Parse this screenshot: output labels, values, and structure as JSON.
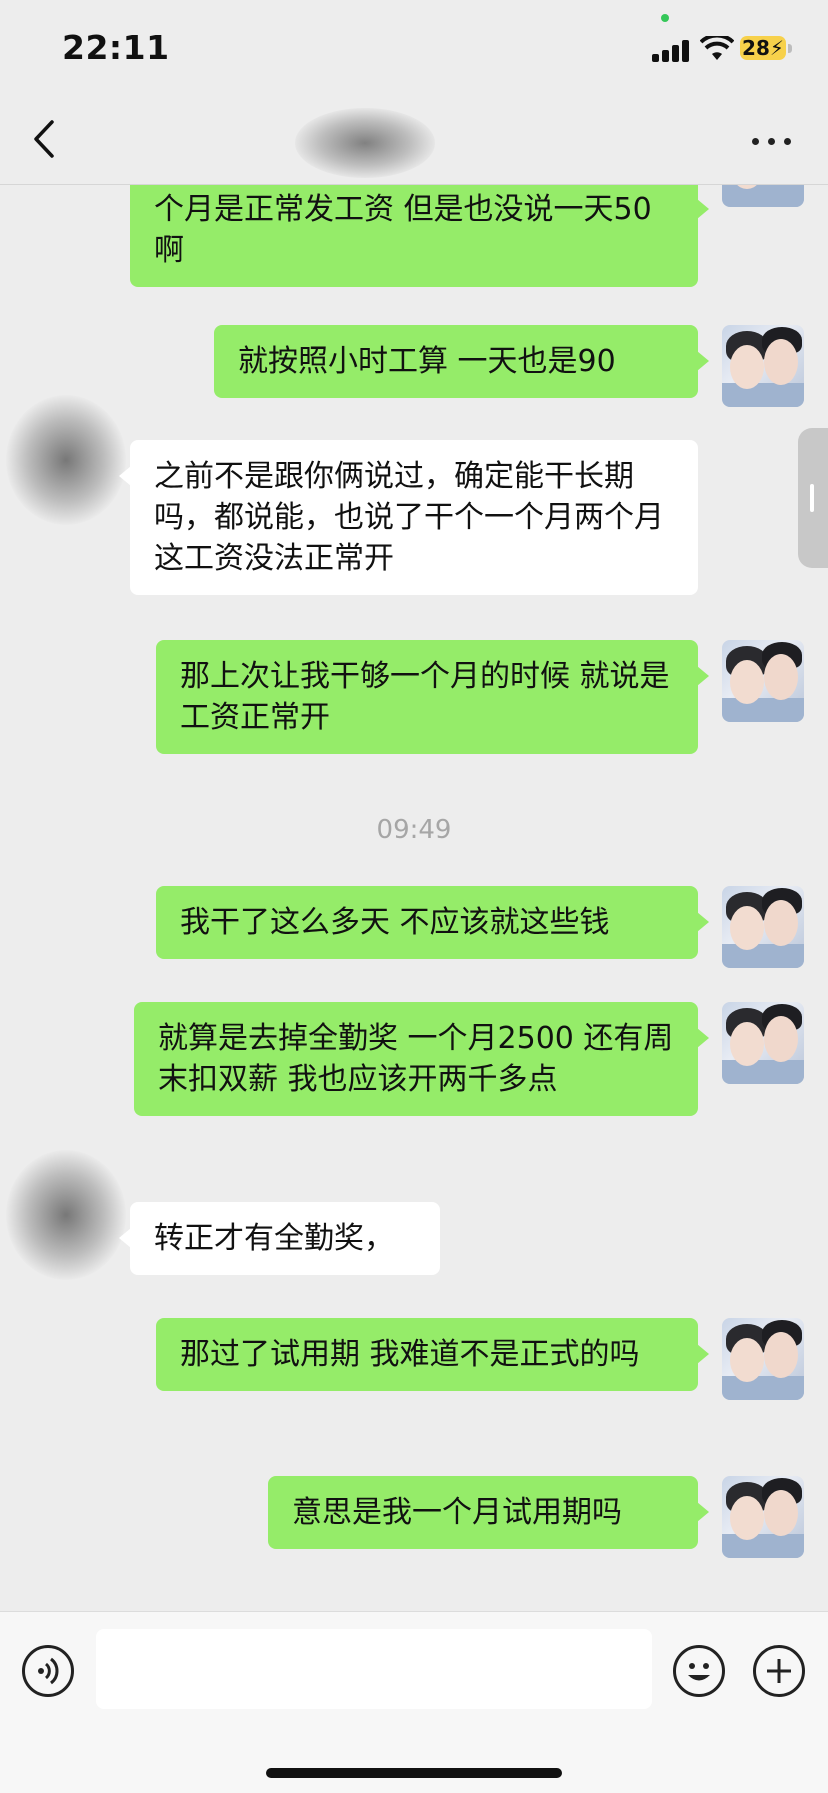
{
  "status_bar": {
    "time": "22:11",
    "battery": "28"
  },
  "nav": {
    "title": ""
  },
  "messages": [
    {
      "side": "sent",
      "text": "个月是正常发工资 但是也没说一天50啊"
    },
    {
      "side": "sent",
      "text": "就按照小时工算 一天也是90"
    },
    {
      "side": "recv",
      "text": "之前不是跟你俩说过，确定能干长期吗，都说能，也说了干个一个月两个月这工资没法正常开"
    },
    {
      "side": "sent",
      "text": "那上次让我干够一个月的时候 就说是工资正常开"
    },
    {
      "type": "time",
      "text": "09:49"
    },
    {
      "side": "sent",
      "text": "我干了这么多天 不应该就这些钱"
    },
    {
      "side": "sent",
      "text": "就算是去掉全勤奖 一个月2500 还有周末扣双薪 我也应该开两千多点"
    },
    {
      "side": "recv",
      "text": "转正才有全勤奖，"
    },
    {
      "side": "sent",
      "text": "那过了试用期 我难道不是正式的吗"
    },
    {
      "side": "sent",
      "text": "意思是我一个月试用期吗"
    }
  ],
  "input": {
    "value": "",
    "placeholder": ""
  },
  "icons": {
    "back": "chevron-left-icon",
    "more": "more-dots-icon",
    "voice": "voice-icon",
    "emoji": "emoji-icon",
    "plus": "plus-icon"
  }
}
